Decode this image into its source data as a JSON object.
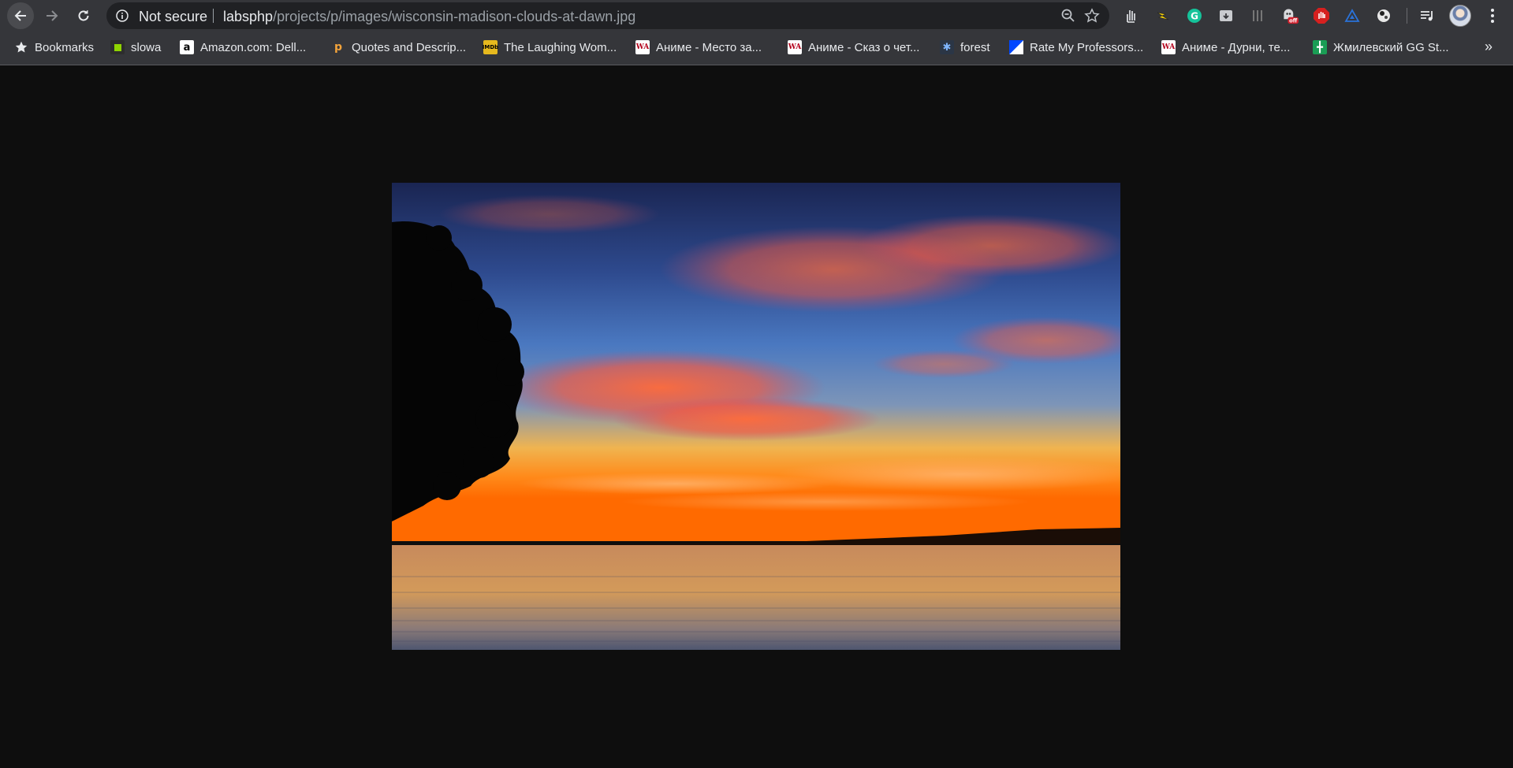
{
  "browser": {
    "omnibox": {
      "security_label": "Not secure",
      "url_host": "labsphp",
      "url_path": "/projects/p/images/wisconsin-madison-clouds-at-dawn.jpg"
    },
    "extensions": [
      {
        "icon": "hand-gesture-icon"
      },
      {
        "icon": "lightning-icon"
      },
      {
        "icon": "grammarly-icon",
        "color": "#15c39a"
      },
      {
        "icon": "archive-icon"
      },
      {
        "icon": "equalizer-icon"
      },
      {
        "icon": "ghost-off-icon",
        "badge": "off"
      },
      {
        "icon": "adblock-hand-icon",
        "color": "#d6201f"
      },
      {
        "icon": "triangle-icon",
        "color": "#2a72d8"
      },
      {
        "icon": "soccer-ball-icon"
      },
      {
        "icon": "media-queue-icon"
      }
    ]
  },
  "bookmarks": {
    "items": [
      {
        "label": "Bookmarks",
        "icon": "star-icon"
      },
      {
        "label": "slowa",
        "icon": "green-square-icon"
      },
      {
        "label": "Amazon.com: Dell...",
        "icon": "amazon-icon"
      },
      {
        "label": "Quotes and Descrip...",
        "icon": "quote-icon"
      },
      {
        "label": "The Laughing Wom...",
        "icon": "imdb-icon"
      },
      {
        "label": "Аниме - Место за...",
        "icon": "wa-icon"
      },
      {
        "label": "Аниме - Сказ о чет...",
        "icon": "wa-icon"
      },
      {
        "label": "forest",
        "icon": "snowflake-icon"
      },
      {
        "label": "Rate My Professors...",
        "icon": "rmp-icon"
      },
      {
        "label": "Аниме - Дурни, те...",
        "icon": "wa-icon"
      },
      {
        "label": "Жмилевский GG St...",
        "icon": "sheets-icon"
      }
    ],
    "overflow": "»"
  },
  "content": {
    "image_name": "wisconsin-madison-clouds-at-dawn.jpg",
    "background_color": "#0e0e0e"
  }
}
